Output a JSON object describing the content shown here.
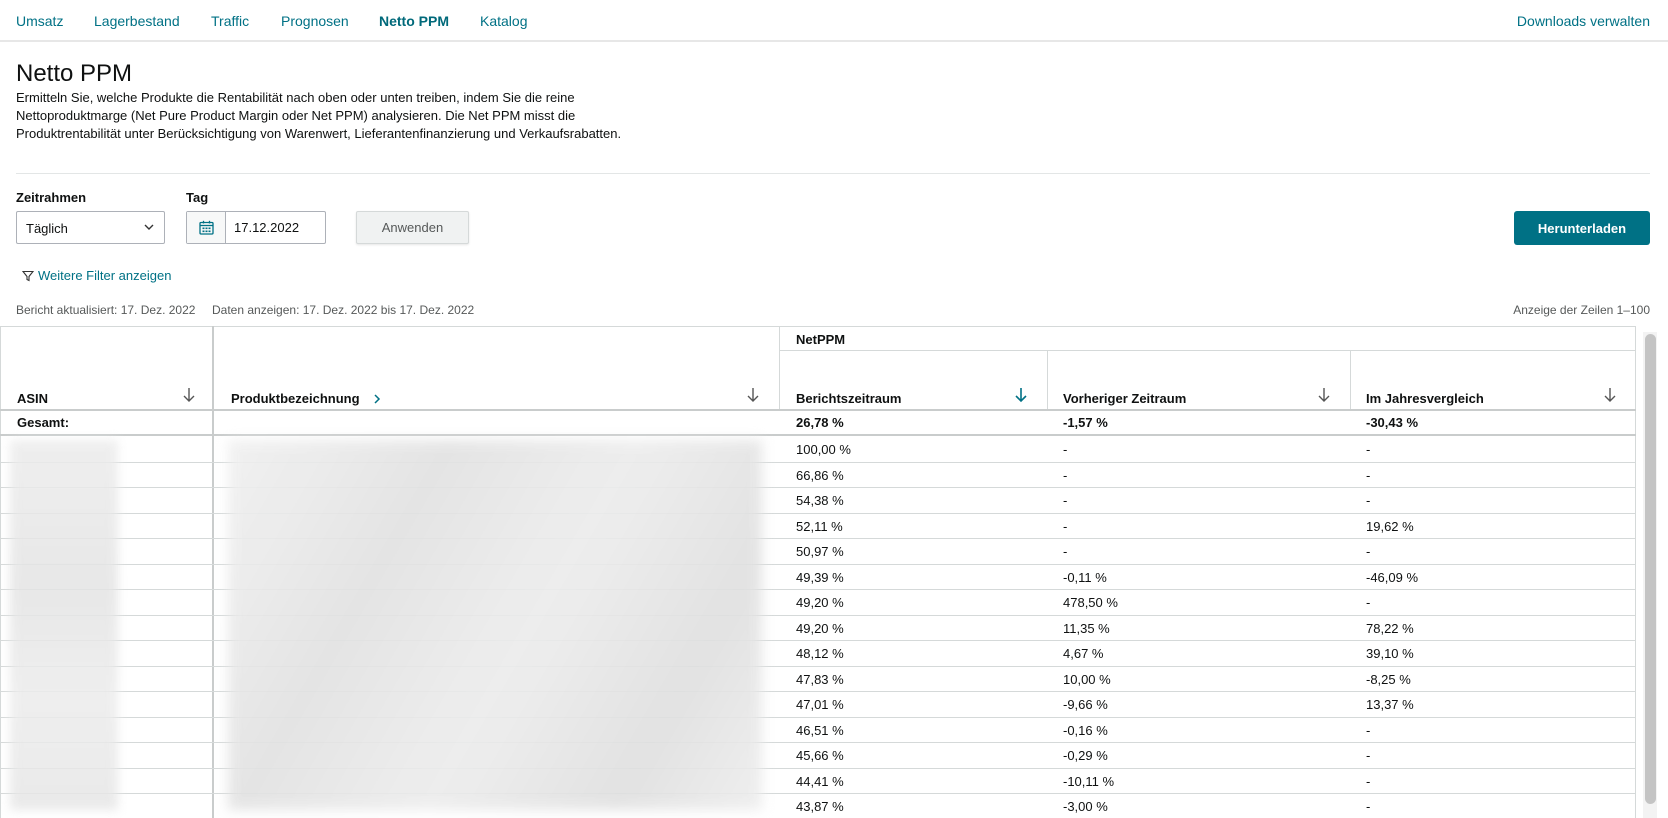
{
  "nav": {
    "tabs": [
      "Umsatz",
      "Lagerbestand",
      "Traffic",
      "Prognosen",
      "Netto PPM",
      "Katalog"
    ],
    "active": "Netto PPM",
    "downloads": "Downloads verwalten"
  },
  "page": {
    "title": "Netto PPM",
    "description": "Ermitteln Sie, welche Produkte die Rentabilität nach oben oder unten treiben, indem Sie die reine Nettoproduktmarge (Net Pure Product Margin oder Net PPM) analysieren. Die Net PPM misst die Produktrentabilität unter Berücksichtigung von Warenwert, Lieferantenfinanzierung und Verkaufsrabatten."
  },
  "filters": {
    "timeframe_label": "Zeitrahmen",
    "timeframe_value": "Täglich",
    "day_label": "Tag",
    "day_value": "17.12.2022",
    "apply": "Anwenden",
    "download": "Herunterladen",
    "more_filters": "Weitere Filter anzeigen"
  },
  "meta": {
    "updated": "Bericht aktualisiert: 17. Dez. 2022",
    "range": "Daten anzeigen: 17. Dez. 2022 bis 17. Dez. 2022",
    "rows": "Anzeige der Zeilen 1–100"
  },
  "table": {
    "group_header": "NetPPM",
    "columns": [
      "ASIN",
      "Produktbezeichnung",
      "Berichtszeitraum",
      "Vorheriger Zeitraum",
      "Im Jahresvergleich"
    ],
    "total_label": "Gesamt:",
    "totals": [
      "26,78 %",
      "-1,57 %",
      "-30,43 %"
    ],
    "rows": [
      [
        "100,00 %",
        "-",
        "-"
      ],
      [
        "66,86 %",
        "-",
        "-"
      ],
      [
        "54,38 %",
        "-",
        "-"
      ],
      [
        "52,11 %",
        "-",
        "19,62 %"
      ],
      [
        "50,97 %",
        "-",
        "-"
      ],
      [
        "49,39 %",
        "-0,11 %",
        "-46,09 %"
      ],
      [
        "49,20 %",
        "478,50 %",
        "-"
      ],
      [
        "49,20 %",
        "11,35 %",
        "78,22 %"
      ],
      [
        "48,12 %",
        "4,67 %",
        "39,10 %"
      ],
      [
        "47,83 %",
        "10,00 %",
        "-8,25 %"
      ],
      [
        "47,01 %",
        "-9,66 %",
        "13,37 %"
      ],
      [
        "46,51 %",
        "-0,16 %",
        "-"
      ],
      [
        "45,66 %",
        "-0,29 %",
        "-"
      ],
      [
        "44,41 %",
        "-10,11 %",
        "-"
      ],
      [
        "43,87 %",
        "-3,00 %",
        "-"
      ]
    ]
  },
  "colors": {
    "accent": "#007185",
    "button": "#007185"
  }
}
